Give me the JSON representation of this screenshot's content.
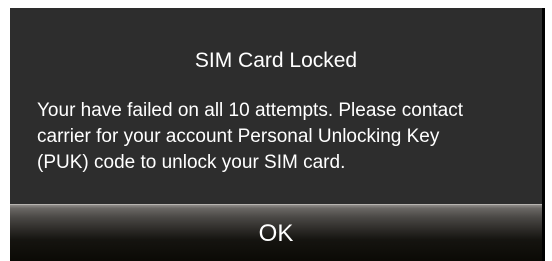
{
  "dialog": {
    "title": "SIM Card Locked",
    "message_lines": [
      "Your have failed on all 10 attempts. Please contact",
      "carrier for your account Personal Unlocking Key",
      "(PUK) code to unlock your SIM card."
    ],
    "ok_label": "OK"
  },
  "colors": {
    "dialog_background": "#2d2d2d",
    "text": "#ffffff",
    "button_top": "#8f8c89",
    "button_bottom": "#0b0a05"
  }
}
